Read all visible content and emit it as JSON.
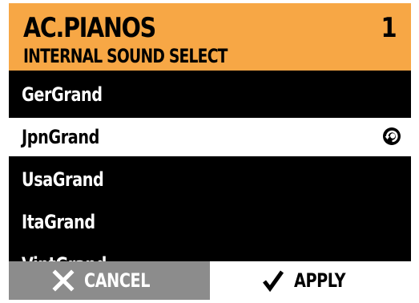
{
  "header": {
    "title": "AC.PIANOS",
    "subtitle": "INTERNAL SOUND SELECT",
    "index": "1",
    "background": "#f7a745"
  },
  "list": {
    "items": [
      {
        "label": "GerGrand",
        "selected": false
      },
      {
        "label": "JpnGrand",
        "selected": true,
        "icon": "selected-indicator-icon"
      },
      {
        "label": "UsaGrand",
        "selected": false
      },
      {
        "label": "ItaGrand",
        "selected": false
      },
      {
        "label": "VintGrand",
        "selected": false
      }
    ]
  },
  "footer": {
    "cancel_label": "CANCEL",
    "cancel_icon": "close-icon",
    "cancel_background": "#8c8c8c",
    "apply_label": "APPLY",
    "apply_icon": "checkmark-icon",
    "apply_background": "#ffffff"
  }
}
